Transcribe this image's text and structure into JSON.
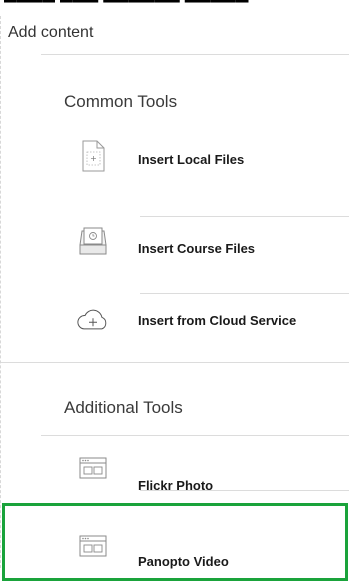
{
  "panel": {
    "title": "Add content"
  },
  "common_tools": {
    "title": "Common Tools",
    "items": [
      {
        "label": "Insert Local Files",
        "icon": "local-file-icon"
      },
      {
        "label": "Insert Course Files",
        "icon": "course-files-icon"
      },
      {
        "label": "Insert from Cloud Service",
        "icon": "cloud-add-icon"
      }
    ]
  },
  "additional_tools": {
    "title": "Additional Tools",
    "items": [
      {
        "label": "Flickr Photo",
        "icon": "flickr-window-icon"
      },
      {
        "label": "Panopto Video",
        "icon": "panopto-window-icon",
        "highlighted": true
      }
    ]
  },
  "colors": {
    "highlight": "#1aa33b",
    "divider": "#dcdcdc"
  }
}
